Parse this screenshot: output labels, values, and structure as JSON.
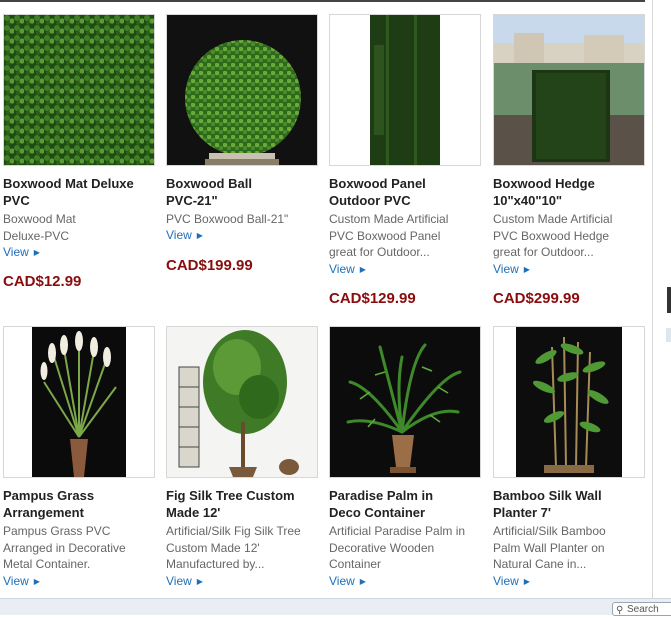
{
  "products": [
    {
      "name_l1": "Boxwood Mat Deluxe",
      "name_l2": "PVC",
      "desc_l1": "Boxwood Mat",
      "desc_l2": "Deluxe-PVC",
      "desc_l3": "",
      "view": "View",
      "price": "CAD$12.99"
    },
    {
      "name_l1": "Boxwood Ball",
      "name_l2": "PVC-21\"",
      "desc_l1": "PVC Boxwood Ball-21\"",
      "desc_l2": "",
      "desc_l3": "",
      "view": "View",
      "price": "CAD$199.99"
    },
    {
      "name_l1": "Boxwood Panel",
      "name_l2": "Outdoor PVC",
      "desc_l1": "Custom Made Artificial",
      "desc_l2": "PVC Boxwood Panel",
      "desc_l3": "great for Outdoor...",
      "view": "View",
      "price": "CAD$129.99"
    },
    {
      "name_l1": "Boxwood Hedge",
      "name_l2": "10\"x40\"10\"",
      "desc_l1": "Custom Made Artificial",
      "desc_l2": "PVC Boxwood Hedge",
      "desc_l3": "great for Outdoor...",
      "view": "View",
      "price": "CAD$299.99"
    },
    {
      "name_l1": "Pampus Grass",
      "name_l2": "Arrangement",
      "desc_l1": "Pampus Grass PVC",
      "desc_l2": "Arranged in Decorative",
      "desc_l3": "Metal Container.",
      "view": "View",
      "price": ""
    },
    {
      "name_l1": "Fig Silk Tree Custom",
      "name_l2": "Made 12'",
      "desc_l1": "Artificial/Silk Fig Silk Tree",
      "desc_l2": "Custom Made 12'",
      "desc_l3": "Manufactured by...",
      "view": "View",
      "price": ""
    },
    {
      "name_l1": "Paradise Palm in",
      "name_l2": "Deco Container",
      "desc_l1": "Artificial Paradise Palm in",
      "desc_l2": "Decorative Wooden",
      "desc_l3": "Container",
      "view": "View",
      "price": ""
    },
    {
      "name_l1": "Bamboo Silk Wall",
      "name_l2": "Planter 7'",
      "desc_l1": "Artificial/Silk Bamboo",
      "desc_l2": "Palm Wall Planter on",
      "desc_l3": "Natural Cane in...",
      "view": "View",
      "price": ""
    }
  ],
  "search": {
    "label": "Search"
  },
  "colors": {
    "price": "#8a0d0d",
    "link": "#1d6fb8",
    "title": "#222222",
    "desc": "#666666"
  }
}
